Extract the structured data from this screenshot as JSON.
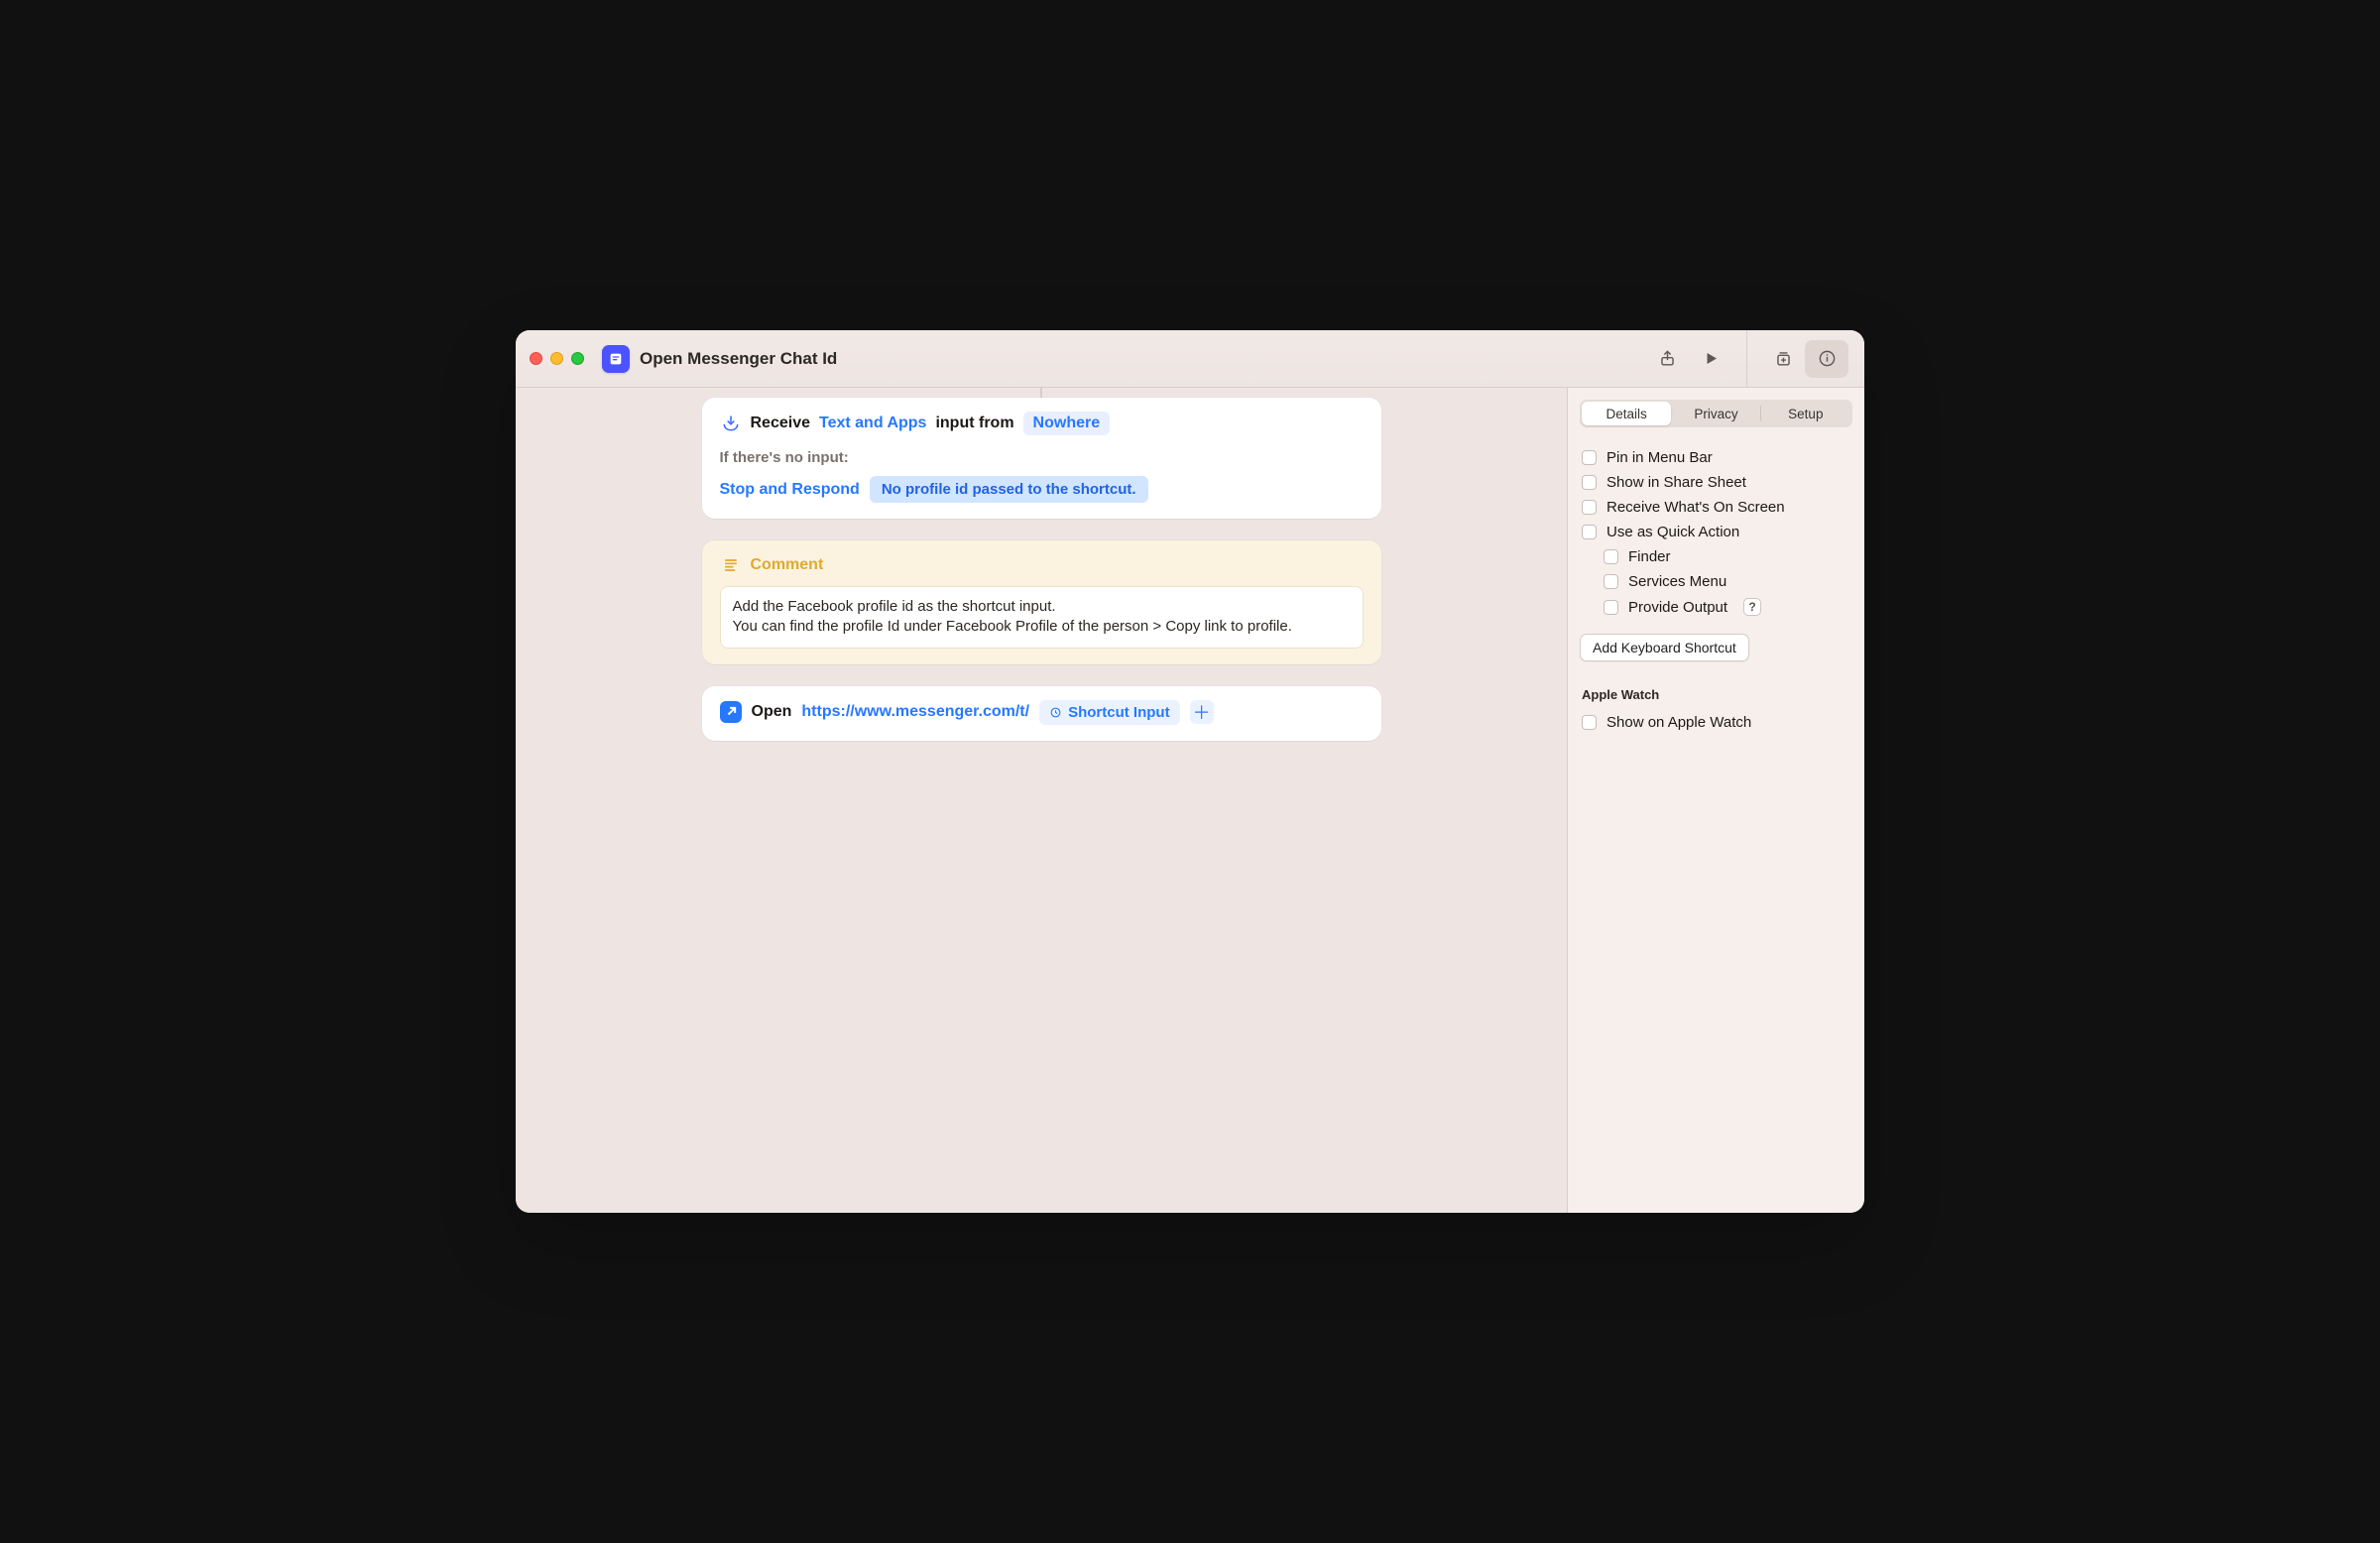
{
  "window": {
    "title": "Open Messenger Chat Id"
  },
  "actions": {
    "receive": {
      "verb": "Receive",
      "types_label": "Text and Apps",
      "mid_text": "input from",
      "source": "Nowhere",
      "no_input_heading": "If there's no input:",
      "no_input_action": "Stop and Respond",
      "no_input_message": "No profile id passed to the shortcut."
    },
    "comment": {
      "title": "Comment",
      "body": "Add the Facebook profile id as the shortcut input.\nYou can find the profile Id under Facebook Profile of the person > Copy link to profile."
    },
    "open_url": {
      "verb": "Open",
      "url": "https://www.messenger.com/t/",
      "variable_label": "Shortcut Input"
    }
  },
  "sidebar": {
    "tabs": {
      "details": "Details",
      "privacy": "Privacy",
      "setup": "Setup"
    },
    "checks": {
      "pin_menu_bar": "Pin in Menu Bar",
      "share_sheet": "Show in Share Sheet",
      "receive_screen": "Receive What's On Screen",
      "quick_action": "Use as Quick Action",
      "finder": "Finder",
      "services_menu": "Services Menu",
      "provide_output": "Provide Output"
    },
    "keyboard_shortcut_button": "Add Keyboard Shortcut",
    "apple_watch_section": "Apple Watch",
    "show_apple_watch": "Show on Apple Watch"
  }
}
